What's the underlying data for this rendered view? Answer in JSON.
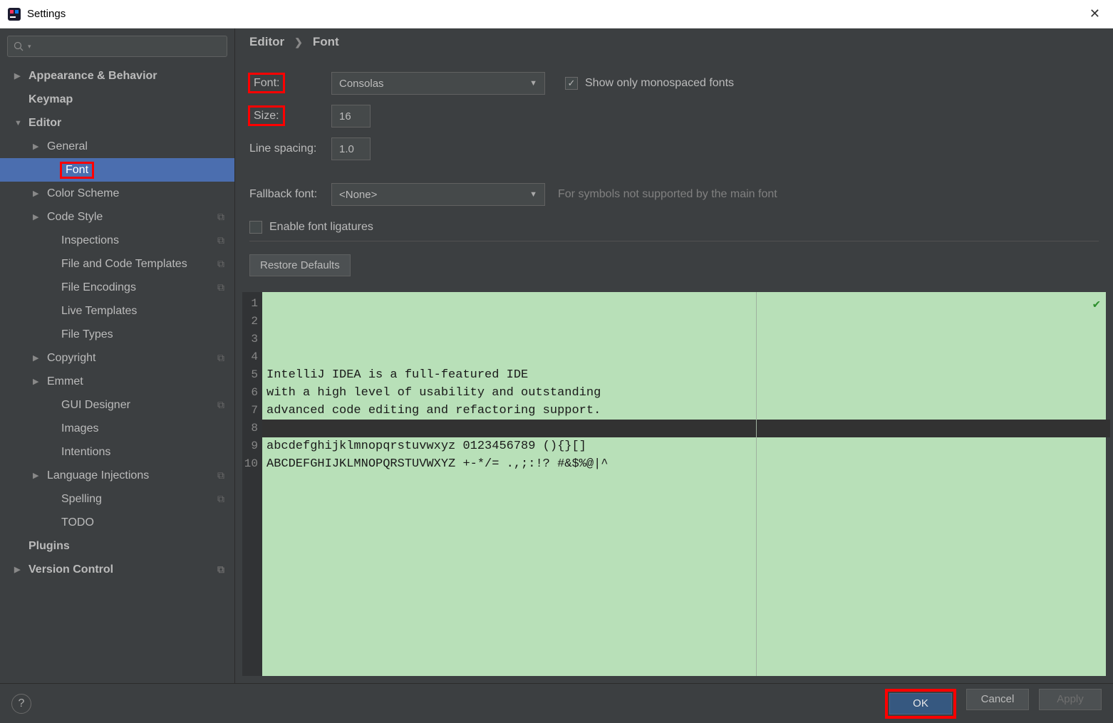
{
  "window": {
    "title": "Settings"
  },
  "sidebar": {
    "search_placeholder": "",
    "items": [
      {
        "label": "Appearance & Behavior",
        "arrow": "▶",
        "bold": true,
        "indent": 0
      },
      {
        "label": "Keymap",
        "arrow": "",
        "bold": true,
        "indent": 0
      },
      {
        "label": "Editor",
        "arrow": "▼",
        "bold": true,
        "indent": 0
      },
      {
        "label": "General",
        "arrow": "▶",
        "bold": false,
        "indent": 1
      },
      {
        "label": "Font",
        "arrow": "",
        "bold": false,
        "indent": 2,
        "selected": true,
        "highlight": true
      },
      {
        "label": "Color Scheme",
        "arrow": "▶",
        "bold": false,
        "indent": 1
      },
      {
        "label": "Code Style",
        "arrow": "▶",
        "bold": false,
        "indent": 1,
        "copy": true
      },
      {
        "label": "Inspections",
        "arrow": "",
        "bold": false,
        "indent": 2,
        "copy": true
      },
      {
        "label": "File and Code Templates",
        "arrow": "",
        "bold": false,
        "indent": 2,
        "copy": true
      },
      {
        "label": "File Encodings",
        "arrow": "",
        "bold": false,
        "indent": 2,
        "copy": true
      },
      {
        "label": "Live Templates",
        "arrow": "",
        "bold": false,
        "indent": 2
      },
      {
        "label": "File Types",
        "arrow": "",
        "bold": false,
        "indent": 2
      },
      {
        "label": "Copyright",
        "arrow": "▶",
        "bold": false,
        "indent": 1,
        "copy": true
      },
      {
        "label": "Emmet",
        "arrow": "▶",
        "bold": false,
        "indent": 1
      },
      {
        "label": "GUI Designer",
        "arrow": "",
        "bold": false,
        "indent": 2,
        "copy": true
      },
      {
        "label": "Images",
        "arrow": "",
        "bold": false,
        "indent": 2
      },
      {
        "label": "Intentions",
        "arrow": "",
        "bold": false,
        "indent": 2
      },
      {
        "label": "Language Injections",
        "arrow": "▶",
        "bold": false,
        "indent": 1,
        "copy": true
      },
      {
        "label": "Spelling",
        "arrow": "",
        "bold": false,
        "indent": 2,
        "copy": true
      },
      {
        "label": "TODO",
        "arrow": "",
        "bold": false,
        "indent": 2
      },
      {
        "label": "Plugins",
        "arrow": "",
        "bold": true,
        "indent": 0
      },
      {
        "label": "Version Control",
        "arrow": "▶",
        "bold": true,
        "indent": 0,
        "copy": true
      }
    ]
  },
  "breadcrumb": {
    "parent": "Editor",
    "current": "Font"
  },
  "form": {
    "font_label": "Font:",
    "font_value": "Consolas",
    "show_mono_label": "Show only monospaced fonts",
    "show_mono_checked": true,
    "size_label": "Size:",
    "size_value": "16",
    "linespacing_label": "Line spacing:",
    "linespacing_value": "1.0",
    "fallback_label": "Fallback font:",
    "fallback_value": "<None>",
    "fallback_hint": "For symbols not supported by the main font",
    "ligatures_label": "Enable font ligatures",
    "ligatures_checked": false,
    "restore_label": "Restore Defaults"
  },
  "preview": {
    "lines": [
      "IntelliJ IDEA is a full-featured IDE",
      "with a high level of usability and outstanding",
      "advanced code editing and refactoring support.",
      "",
      "abcdefghijklmnopqrstuvwxyz 0123456789 (){}[]",
      "ABCDEFGHIJKLMNOPQRSTUVWXYZ +-*/= .,;:!? #&$%@|^",
      "",
      "",
      "",
      ""
    ],
    "current_line_index": 3
  },
  "footer": {
    "ok": "OK",
    "cancel": "Cancel",
    "apply": "Apply"
  }
}
